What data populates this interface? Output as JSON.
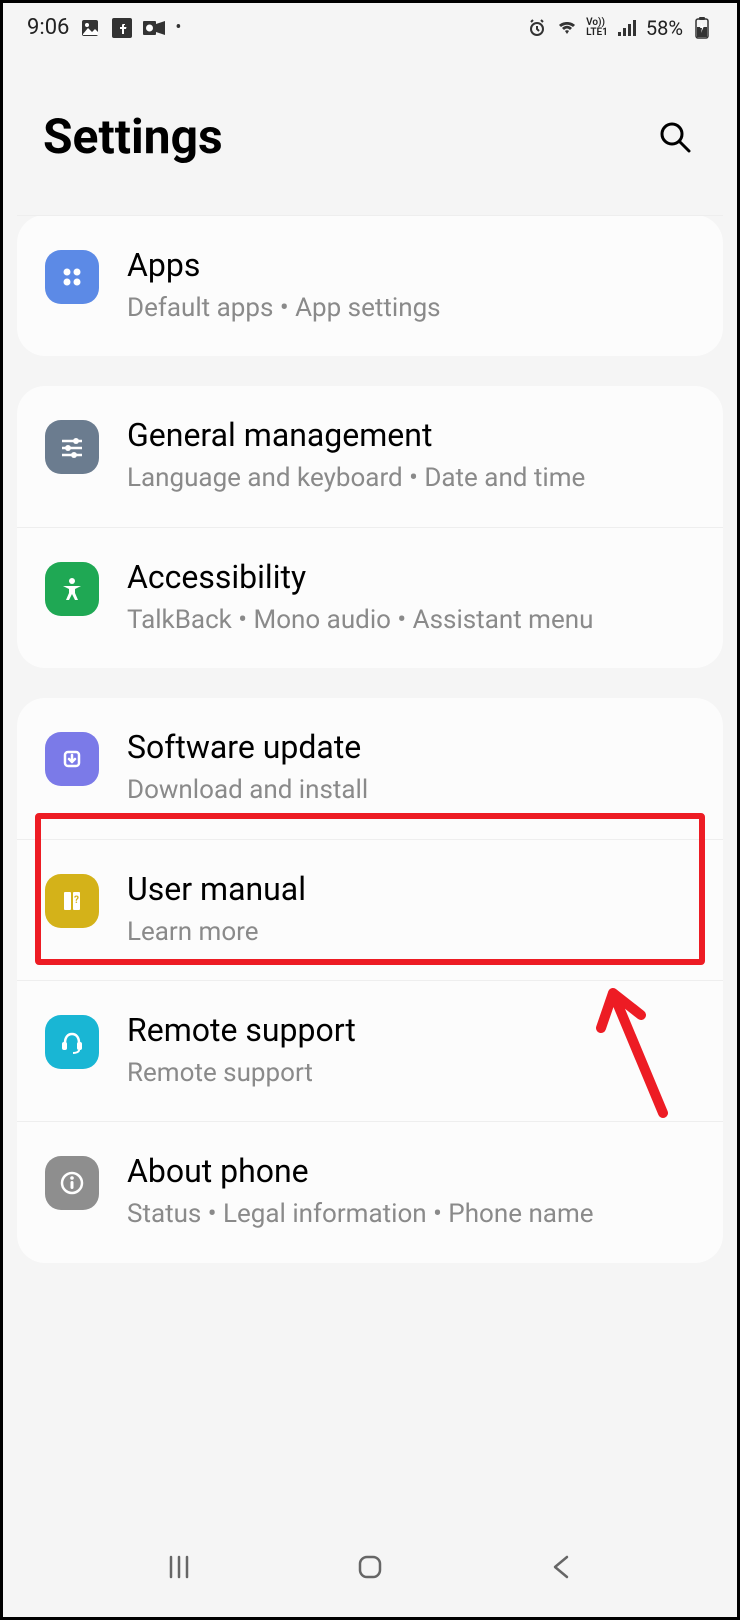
{
  "status_bar": {
    "time": "9:06",
    "battery": "58%"
  },
  "header": {
    "title": "Settings"
  },
  "sections": [
    {
      "items": [
        {
          "id": "apps",
          "title": "Apps",
          "subtitle": "Default apps  •  App settings",
          "icon": "apps-icon",
          "icon_color": "#5c8ae6"
        }
      ]
    },
    {
      "items": [
        {
          "id": "general-management",
          "title": "General management",
          "subtitle": "Language and keyboard  •  Date and time",
          "icon": "sliders-icon",
          "icon_color": "#6b7c8f"
        },
        {
          "id": "accessibility",
          "title": "Accessibility",
          "subtitle": "TalkBack  •  Mono audio  •  Assistant menu",
          "icon": "person-icon",
          "icon_color": "#1fa854"
        }
      ]
    },
    {
      "items": [
        {
          "id": "software-update",
          "title": "Software update",
          "subtitle": "Download and install",
          "icon": "download-icon",
          "icon_color": "#7b7ae8",
          "highlighted": true
        },
        {
          "id": "user-manual",
          "title": "User manual",
          "subtitle": "Learn more",
          "icon": "book-icon",
          "icon_color": "#d4b219"
        },
        {
          "id": "remote-support",
          "title": "Remote support",
          "subtitle": "Remote support",
          "icon": "headset-icon",
          "icon_color": "#19b6d4"
        },
        {
          "id": "about-phone",
          "title": "About phone",
          "subtitle": "Status  •  Legal information  •  Phone name",
          "icon": "info-icon",
          "icon_color": "#8e8e8e"
        }
      ]
    }
  ],
  "annotation": {
    "highlight_target": "software-update",
    "arrow": true
  }
}
